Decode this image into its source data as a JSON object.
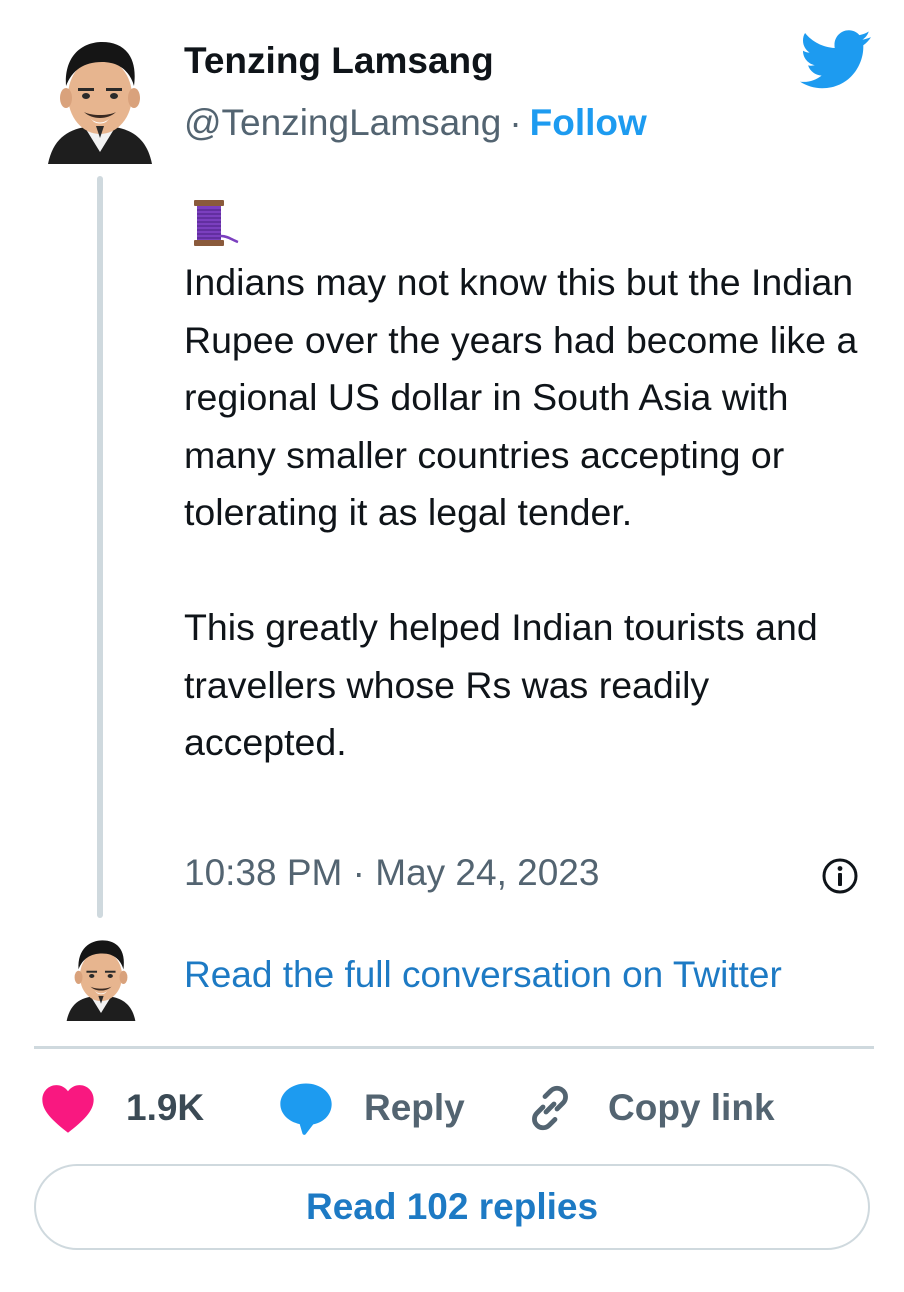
{
  "author": {
    "name": "Tenzing Lamsang",
    "handle": "@TenzingLamsang",
    "separator": "·",
    "follow_label": "Follow"
  },
  "tweet": {
    "leading_emoji_icon": "thread-spool-icon",
    "paragraphs": [
      "Indians may not know this but the Indian Rupee over the years had become like a regional US dollar in South Asia with many smaller countries accepting or tolerating it as legal tender.",
      "This greatly helped Indian tourists and travellers whose Rs was readily accepted."
    ],
    "timestamp": "10:38 PM · May 24, 2023"
  },
  "conversation": {
    "read_full_label": "Read the full conversation on Twitter"
  },
  "actions": {
    "like_count": "1.9K",
    "reply_label": "Reply",
    "copy_link_label": "Copy link"
  },
  "footer": {
    "read_replies_label": "Read 102 replies"
  },
  "colors": {
    "twitter_blue": "#1d9bf0",
    "link_blue": "#1d7ac4",
    "heart_pink": "#f91880",
    "text_dark": "#0f1419",
    "text_gray": "#536471",
    "divider": "#cfd9de"
  },
  "icons": {
    "brand": "twitter-bird-icon",
    "info": "info-icon",
    "like": "heart-icon",
    "reply": "speech-bubble-icon",
    "copy": "link-icon"
  }
}
